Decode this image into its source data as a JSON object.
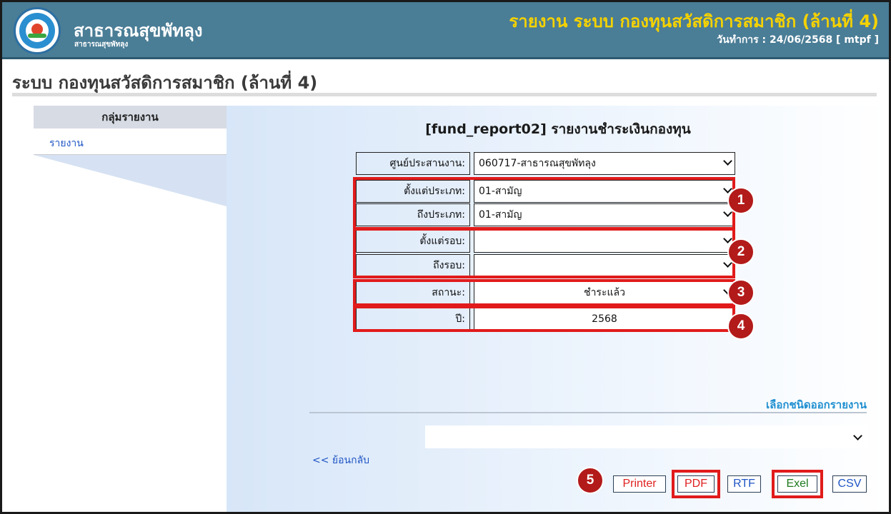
{
  "header": {
    "site_name": "สาธารณสุขพัทลุง",
    "site_sub": "สาธารณสุขพัทลุง",
    "report_title": "รายงาน ระบบ กองทุนสวัสดิการสมาชิก (ล้านที่ 4)",
    "run_date": "วันทำการ : 24/06/2568 [ mtpf ]"
  },
  "page": {
    "title": "ระบบ กองทุนสวัสดิการสมาชิก (ล้านที่ 4)"
  },
  "sidebar": {
    "heading": "กลุ่มรายงาน",
    "items": [
      {
        "label": "รายงาน"
      }
    ]
  },
  "form": {
    "title": "[fund_report02] รายงานชำระเงินกองทุน",
    "fields": [
      {
        "label": "ศูนย์ประสานงาน:",
        "value": "060717-สาธารณสุขพัทลุง"
      },
      {
        "label": "ตั้งแต่ประเภท:",
        "value": "01-สามัญ"
      },
      {
        "label": "ถึงประเภท:",
        "value": "01-สามัญ"
      },
      {
        "label": "ตั้งแต่รอบ:",
        "value": ""
      },
      {
        "label": "ถึงรอบ:",
        "value": ""
      },
      {
        "label": "สถานะ:",
        "value": "ชำระแล้ว"
      },
      {
        "label": "ปี:",
        "value": "2568"
      }
    ]
  },
  "output": {
    "section_title": "เลือกชนิดออกรายงาน",
    "selected_format": "",
    "back_link": "<< ย้อนกลับ",
    "buttons": {
      "printer": "Printer",
      "pdf": "PDF",
      "rtf": "RTF",
      "excel": "Exel",
      "csv": "CSV"
    }
  },
  "annotations": {
    "badge_1": "1",
    "badge_2": "2",
    "badge_3": "3",
    "badge_4": "4",
    "badge_5": "5"
  },
  "colors": {
    "header_bg": "#4a7d96",
    "report_title": "#f5d200",
    "highlight": "#e11b1b",
    "badge": "#b31a1a",
    "link": "#1f55c5",
    "section_title": "#1f8fd0",
    "btn_printer": "#e02020",
    "btn_pdf": "#e02020",
    "btn_rtf": "#1f55c5",
    "btn_excel": "#1d7a1d",
    "btn_csv": "#1f55c5"
  }
}
